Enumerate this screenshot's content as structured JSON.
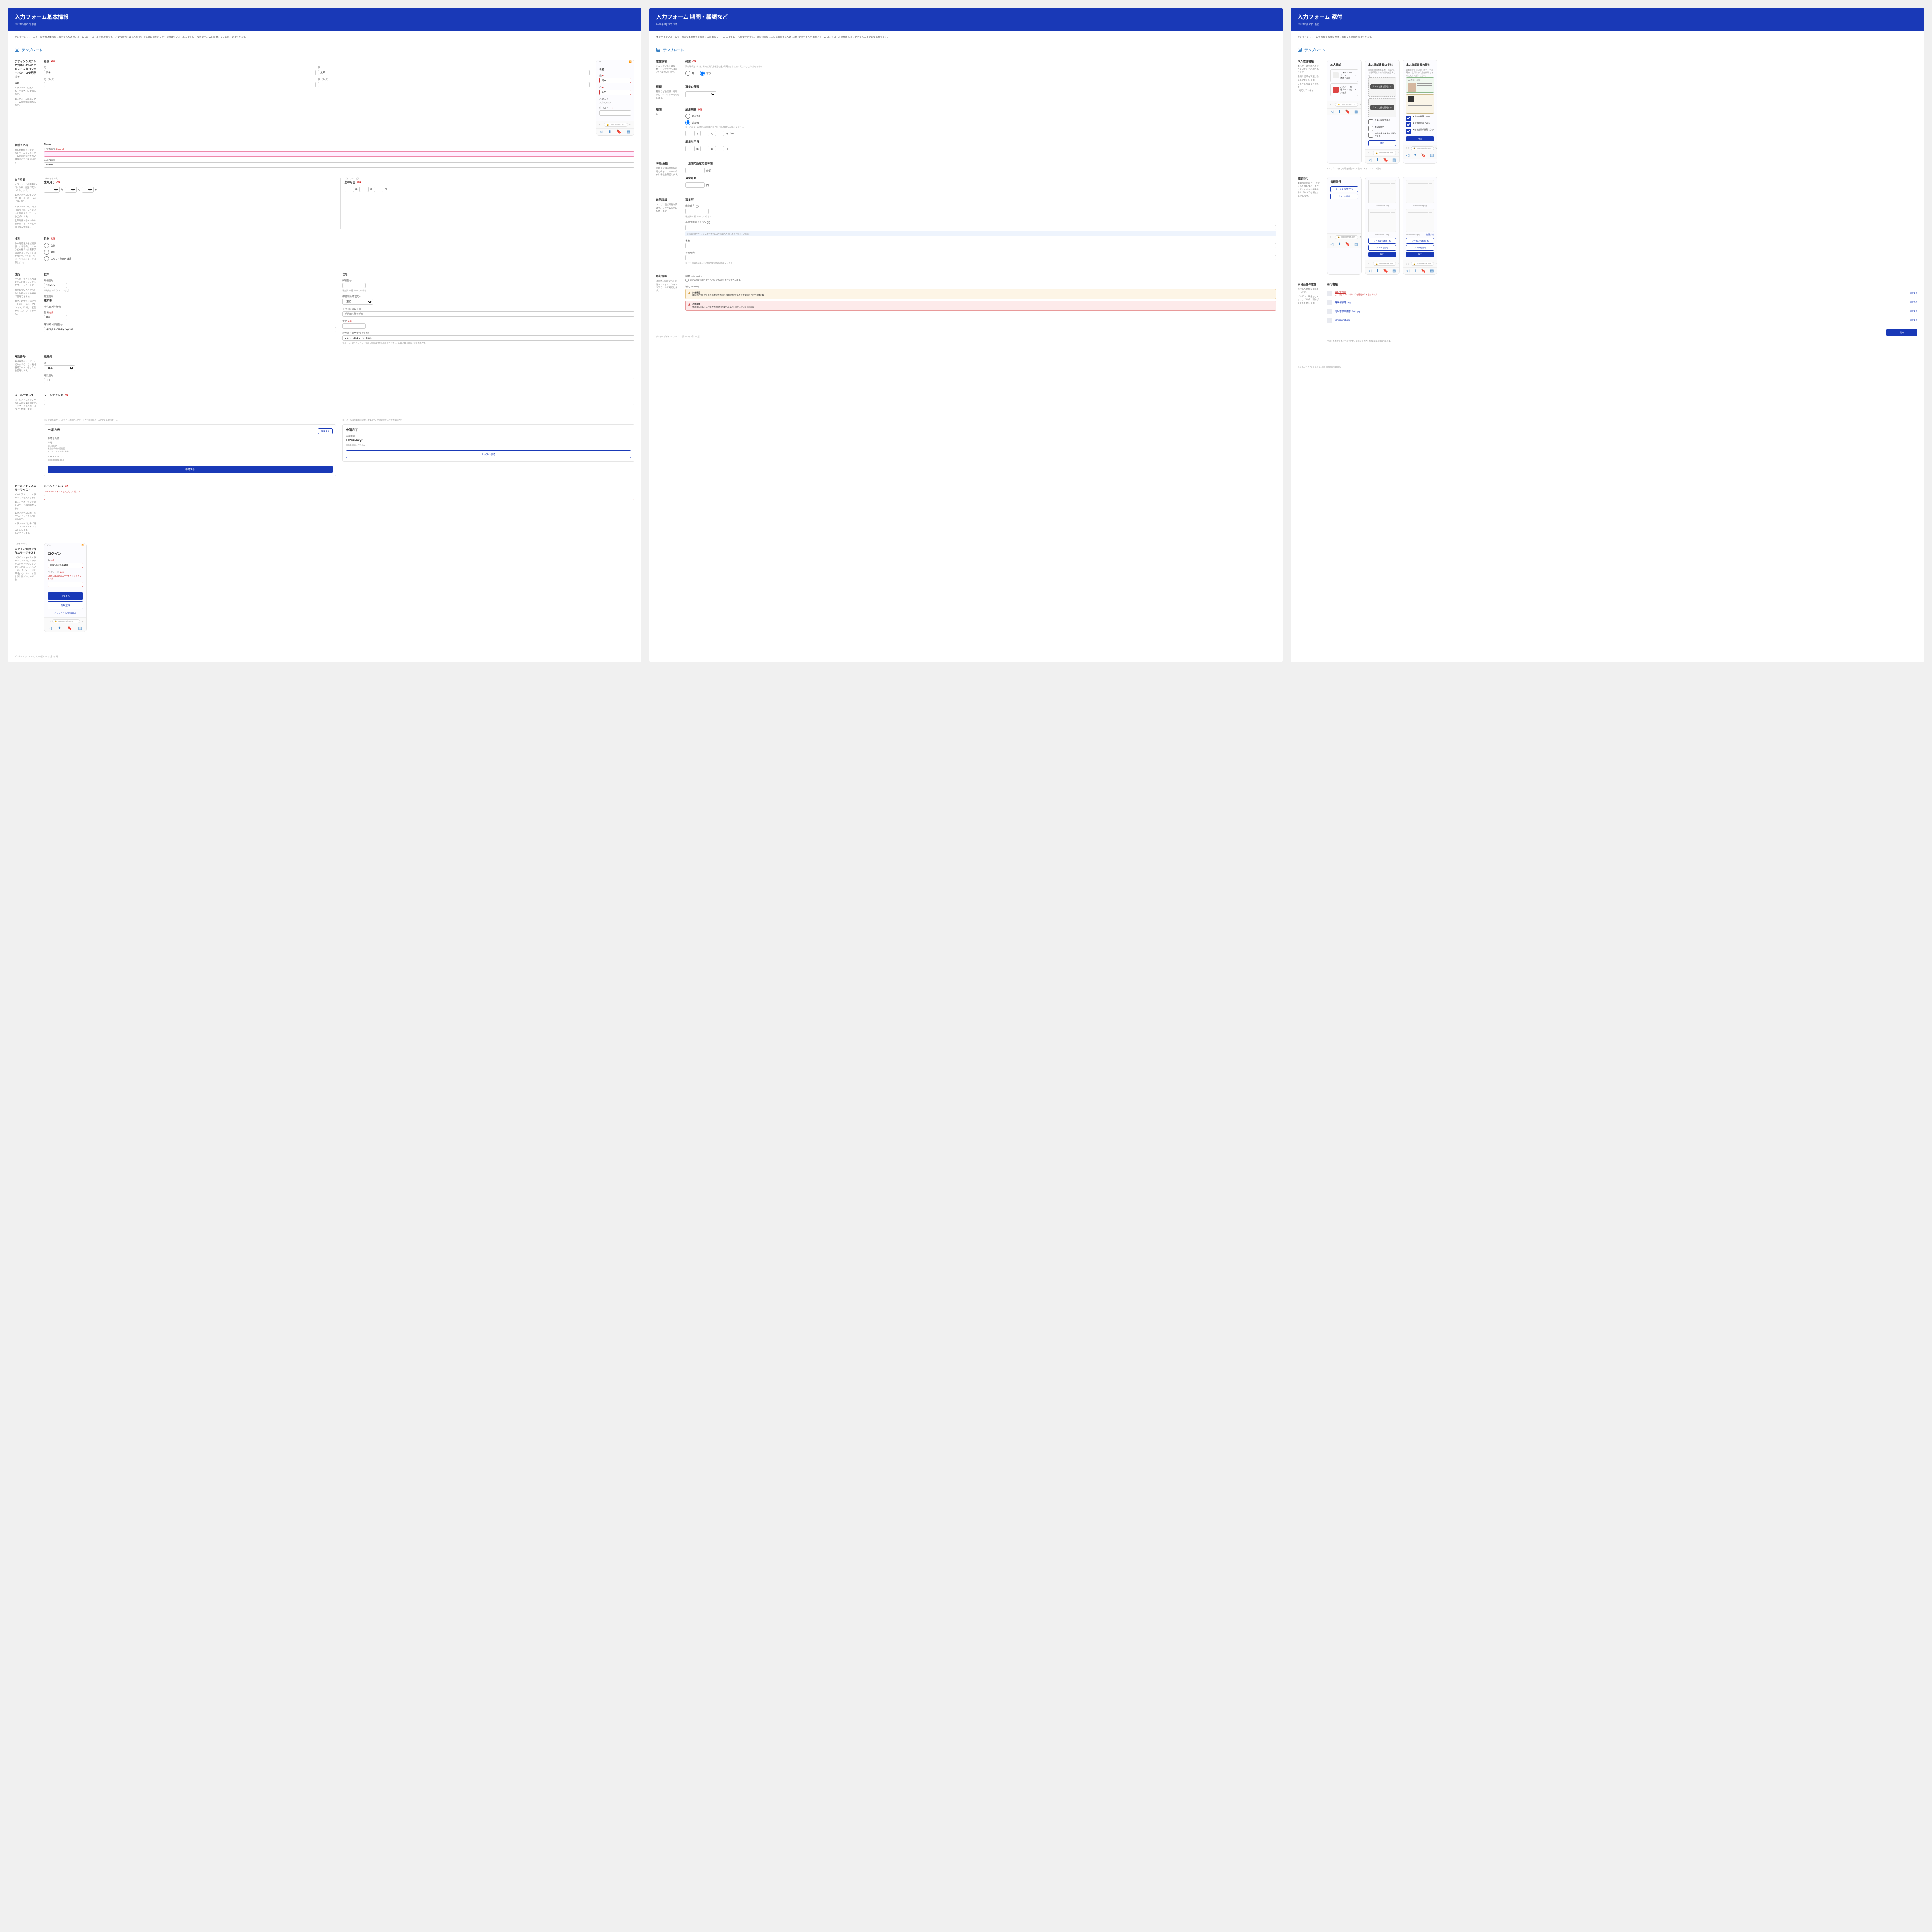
{
  "p1": {
    "title": "入力フォーム基本情報",
    "date": "2022年3月15日 作成",
    "intro": "オンラインフォームで一般的な基本情報を取得するためのフォーム コントロールの使用例です。\n必要な情報を正しく取得するためにはわかりやすく明確なフォーム コントロールの使用方法を提供することが必要となります。",
    "tmpl": "テンプレート",
    "s_name": {
      "h": "名前",
      "d1": "デザインシステムで定義しているテキスト入力コンポーネントの使用例です",
      "d2": "エラフォームは姓と名、それぞれに要求します。",
      "d3": "エラフォームはエラフォームの横幅に関係します。",
      "lbl": "名前",
      "req": "必須",
      "sei": "姓",
      "mei": "名",
      "sei_v": "鈴木",
      "mei_v": "太郎",
      "sei_k": "姓（カナ）",
      "mei_k": "名（カナ）",
      "ph_lbl": "名前",
      "ph_sei_l": "姓",
      "ph_v1": "鈴木",
      "ph_mei_l": "名",
      "ph_v2": "太郎",
      "ph_kana_h": "名前カナ：",
      "ph_kana_v": "スズキタロウ",
      "ph_seik_l": "姓（カナ）"
    },
    "s_name2": {
      "h": "名前その他",
      "d": "運転免許証などファーストネームとラストネームの区別が付かない場合はこちらを使います。",
      "lbl": "Name",
      "fn": "First Name",
      "fn_v": "Required",
      "ln": "Last Name"
    },
    "s_birth": {
      "h": "生年月日",
      "d1": "エラフォームの要素を2行に分け、配置が変わったり、より、",
      "d2": "エラフォームはセレクター月、月日は、「年」「月」「日」。",
      "d3": "エラフォームをEHC使う。",
      "d4": "エラフォームの月日は月表示では、プルダウンを使用するパターンもございます。",
      "d5": "生年月日からインカムを取得することで生年月日の有効性を。",
      "lbl": "生年月日",
      "lbl2": "（セレクター式）",
      "lbl3": "（インプット式）",
      "req": "必須",
      "y": "年",
      "m": "月",
      "d": "日"
    },
    "s_sex": {
      "h": "性別",
      "d": "本人確認性別を記載事項にする場合はスルーなどを行うと記載事項に必要としないようになります。1つ目：コード、ラジオボタンで対応します。",
      "lbl": "性別",
      "req": "必須",
      "o1": "女性",
      "o2": "男性",
      "o3": "こちら・無回答確認"
    },
    "s_addr": {
      "h": "住所",
      "d1": "住所のテキスト入力はできるだけシティプルなフォームにします。",
      "d2": "郵便番号の入力からすると住所自動入力機能が使用できます。",
      "d3": "番地、建物などはアパートメントビル、マンション、ビルは、区別形式入力にはいりません。",
      "lbl": "住所",
      "zip_l": "郵便番号",
      "zip_h": "半角数字7桁（ハイフンなし）",
      "zip_v": "1234567",
      "pref_l": "都道府県",
      "pref_v": "東京都",
      "city_l": "千代田区駐留千町",
      "addr_l": "番地",
      "addr_req": "必須",
      "addr_v": "0-0",
      "bldg_l": "建物名・部屋番号",
      "bldg_v": "デジタルビルディング201",
      "lbl2": "住所",
      "zip2": "郵便番号",
      "zip2h": "半角数字7桁（ハイフンなし）",
      "pref2": "都道府県/市区町村",
      "addr2": "千代田区駐留千町",
      "addr2h": "番地",
      "b2": "建物名・部屋番号（任意）",
      "b2v": "デジタルビルディング201",
      "b2h": "アパート・マンション・ビル名・部屋番号を入力してください。記載が無い場合は記入不要です。"
    },
    "s_tel": {
      "h": "電話番号",
      "d": "電話番号をユーザーに記入させるときは電話番号テキストボックスを使用します。",
      "lbl": "連絡先",
      "c_l": "国",
      "c_v": "日本",
      "tel_l": "電話番号",
      "tel_v": "TEL"
    },
    "s_mail": {
      "h": "メールアドレス",
      "d": "メールアドレスのテキスト入力の使用例です。「＠マークの入力」について動作します。",
      "lbl": "メールアドレス",
      "req": "必須"
    },
    "s_conf": {
      "d1": "※：正式な動作メールアドレスにアップデートされた日時メールアドレス対パターン。",
      "d2": "※：メールは自動的に却申しますので、申請処理時はご注意ください",
      "c1_h": "申請内容",
      "c1_btn": "編集する",
      "c1_nm": "申請者氏名",
      "c1_addr": "住所",
      "c1_addr_v": "〒1234567\n東京都千代田区駐留\nメールアドレスはこちら",
      "c1_mail": "メールアドレス",
      "c1_mail_v": "ukoto@digital.go.jp",
      "c1_submit": "申請する",
      "c2_h": "申請完了",
      "c2_no_l": "申請番号",
      "c2_no": "0123456xyz",
      "c2_note": "申請後照会はこちらへ",
      "c2_btn": "トップへ戻る"
    },
    "s_err": {
      "h": "メールアドレスエラーテキスト",
      "d1": "メールアドレスにエラテキストを入力します。",
      "d2": "エラテキストをアクセシビリティには配置します。",
      "d3": "エラフォームは赤「メールアドレスを入力」とします。",
      "d4": "エラフォームは赤「既にこのメールアドレスは」とします。",
      "d5": "とアウトします。",
      "lbl": "メールアドレス",
      "err": "Error メールアドレスを入力してください"
    },
    "s_login": {
      "tag": "【参考ページ】",
      "h": "ログイン画面で存在エラーテキスト",
      "d": "ログインフォームエラテキストまたはエラテキストをアクセシビリティに配置し。パスワードを「パスワードを保持」をログインするようにはパスワードを。",
      "title": "ログイン",
      "id_l": "ID",
      "id_v": "erroruser@digital",
      "id_e": "",
      "pw_l": "パスワード",
      "pw_e": "Error IDまたはパスワードが正しくありません",
      "btn": "ログイン",
      "btn2": "新規登録",
      "forgot": "パスワードをお忘れの方"
    }
  },
  "p2": {
    "title": "入力フォーム 期間・種類など",
    "date": "2022年3月15日 作成",
    "intro": "オンラインフォームで一般的な基本情報を取得するためのフォーム コントロールの使用例です。\n必要な情報を正しく取得するためには分かりやすく明確なフォーム コントロールの使用方法を提供することが必要となります。",
    "tmpl": "テンプレート",
    "s_conf": {
      "h": "確認事項",
      "d": "チェックリストは複数、ラジオボタンはある1つを想定します。",
      "lbl": "確認",
      "req": "必須",
      "q": "再就職手当または、常用就職支度手当を離入所月日より以前に受けたことがありますか？",
      "o1": "無",
      "o2": "有り"
    },
    "s_type": {
      "h": "種類",
      "d": "種類などを選択する場合は、セレクターで対応します。",
      "lbl": "事業の種類"
    },
    "s_period": {
      "h": "期間",
      "d": "日",
      "lbl": "雇用期間",
      "req": "必須",
      "o1": "特になし",
      "o2": "定める",
      "inp_l": "※「定める」の場合は開始年月日と終了年月日を入力してください。",
      "y": "年",
      "m": "月",
      "to": "から",
      "lbl2": "雇用年月日"
    },
    "s_money": {
      "h": "時給/金額",
      "d": "時給や金額は単位のあるものを。フォームの右に単位を配置します。",
      "lbl1": "一週間の所定労働時間",
      "u1": "時間",
      "lbl2": "賃金月額",
      "u2": "円"
    },
    "s_add": {
      "h": "追記情報",
      "d": "ユーザー追記可能な情報を。フォームの他に配置します。",
      "lbl": "事業所",
      "zip_l": "郵便番号",
      "zip_h": "半角数字7桁（ハイフンなし）",
      "chk_l": "事業所番号チェック",
      "chk_h": "※ 事業所が存在しない場合番号により事業名と所在地を自動入力されます",
      "name_l": "名称",
      "na_l": "不在理由",
      "na_h": "※ 不在理由を記載し対応が必要な際連絡お願いします"
    },
    "s_help": {
      "h": "追記情報",
      "d": "注意喚起について何具はインフォメーションやアラートで対応します。",
      "info_h": "補足 Information",
      "info_t": "追記の補足情報・留守・お知らせのメッセージが入ります。",
      "warn_h": "補足 Warning",
      "a1_h": "対象確認",
      "a1_t": "申請日に対して入所日が確認できないが確認日までみなさす場合について注意記載",
      "a2_h": "注意事項",
      "a2_t": "申請日に対して入所日が無効日付の扱いみなさす場合について注意記載"
    }
  },
  "p3": {
    "title": "入力フォーム 添付",
    "date": "2022年3月15日 作成",
    "intro": "オンラインフォームで書類や画像の添付を求める際の注意点となります。",
    "tmpl": "テンプレート",
    "s_id": {
      "h": "本人確認書類",
      "d1": "本人が正式な本人なのか見定を行う必要があります。",
      "d2": "書類と書類を不正は防止処理を行います。",
      "d3": "テキストやキメモの設定\n• 対応しています",
      "c1_h": "本人確認",
      "att1": "マイナンバーカード\n表面と裏面",
      "att2": "パスポート在留カードなど\n対象外",
      "c2_h": "本人確認書類の提出",
      "c2_d": "運転免許証意象の表、裏における書類写し等目的別代用証人も可",
      "dz_btn": "カメラで撮を開始する",
      "chk1": "氏名が鮮明である",
      "chk2": "有効期限内",
      "chk3": "画像体全体を文字が識別できる",
      "c2_btn": "確認",
      "c3_h": "本人確認書類の提出",
      "c3_d": "運転免許証に記載：氏名・生年月日・住所等の文字が鮮明であることを確認ください。",
      "id_lbl": "▲ 表面、裏面",
      "c3c1": "■ 氏名が鮮明である",
      "c3c2": "■ 有効期限内である",
      "c3c3": "■ 画像全体が識別できる",
      "c3_btn": "確認"
    },
    "s_doc": {
      "h": "書類添付",
      "d": "書類の添付など、『ファイルを選択する』ボタンで。モバイル端末の場合『カメラを開始』処理します。",
      "c_h": "書類添付",
      "btn1": "ファイルを選択する",
      "btn2": "カメラを開始",
      "fn1": "screenshot.png",
      "fn2": "screenshot1.png",
      "submit": "提出"
    },
    "s_prev": {
      "h": "添付画像の確認",
      "d1": "添付した書類の確認を行います。",
      "d2": "プレビュー画像もしくはファイル名、削除ボタンを配置します。",
      "lbl": "添付書類",
      "f1": "運転免許証",
      "f1e": "これではファイルサイズpg超過のため合計サイズ",
      "f2": "健康保険証.png",
      "f3": "対象書類申請書_001.jpg",
      "f4": "screenshot.png",
      "del": "削除する",
      "btn": "提出",
      "note": "申請する書類サイズチェックを。対象外有無含む情報まま方法表示します。"
    }
  },
  "footer": "デジタルデザインシステム1.0版 2022年3月15日版"
}
